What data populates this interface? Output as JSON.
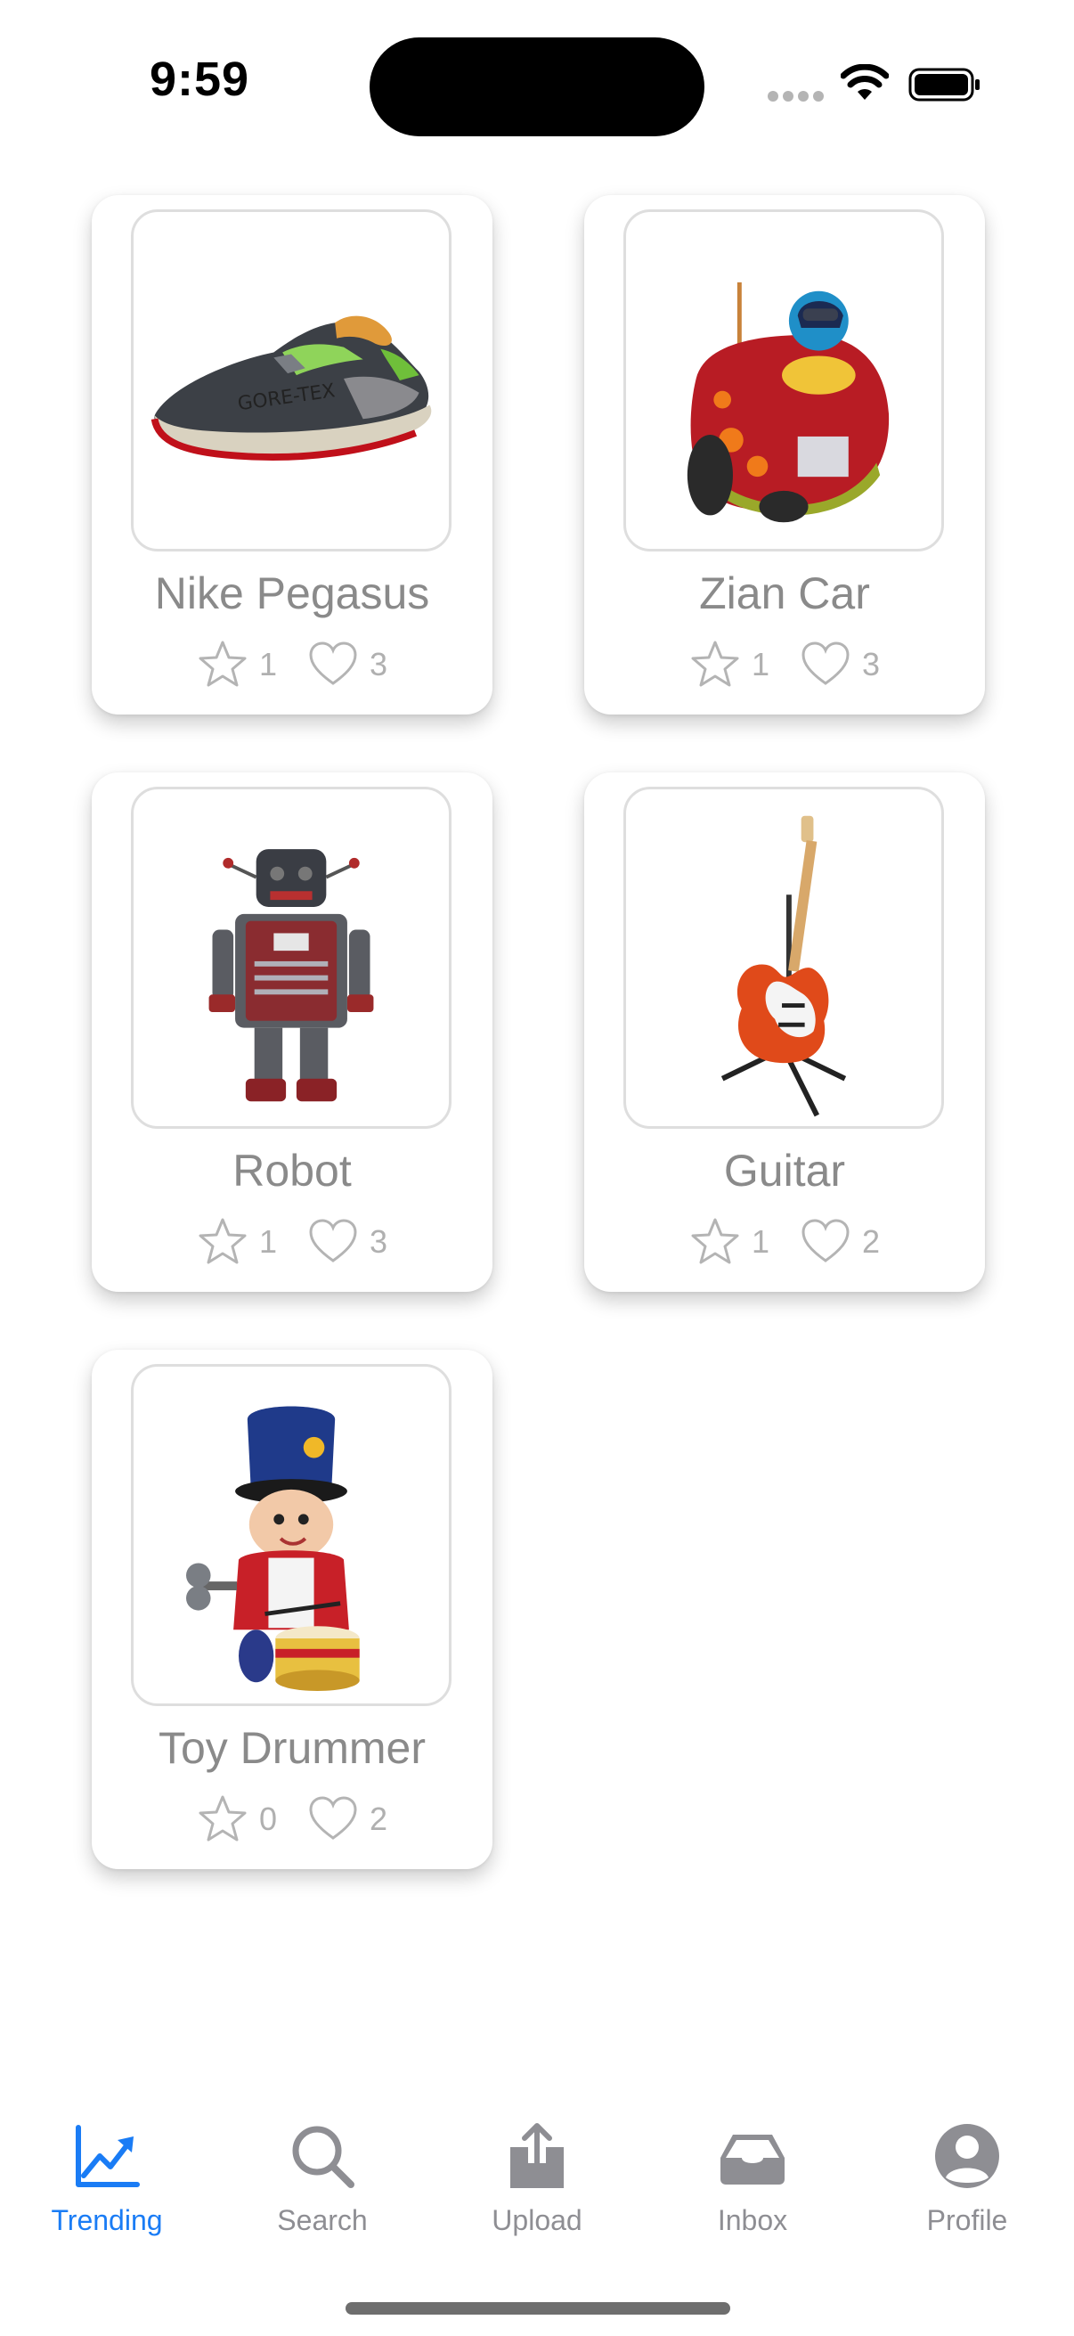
{
  "status_bar": {
    "time": "9:59"
  },
  "items": [
    {
      "title": "Nike Pegasus",
      "stars": "1",
      "likes": "3"
    },
    {
      "title": "Zian Car",
      "stars": "1",
      "likes": "3"
    },
    {
      "title": "Robot",
      "stars": "1",
      "likes": "3"
    },
    {
      "title": "Guitar",
      "stars": "1",
      "likes": "2"
    },
    {
      "title": "Toy Drummer",
      "stars": "0",
      "likes": "2"
    }
  ],
  "tabs": [
    {
      "label": "Trending",
      "icon": "trending-chart-icon",
      "active": true
    },
    {
      "label": "Search",
      "icon": "magnifier-icon",
      "active": false
    },
    {
      "label": "Upload",
      "icon": "upload-icon",
      "active": false
    },
    {
      "label": "Inbox",
      "icon": "inbox-tray-icon",
      "active": false
    },
    {
      "label": "Profile",
      "icon": "person-circle-icon",
      "active": false
    }
  ],
  "colors": {
    "accent": "#1a7cf5",
    "inactive": "#8e8e93",
    "muted": "#b0b0b0"
  }
}
